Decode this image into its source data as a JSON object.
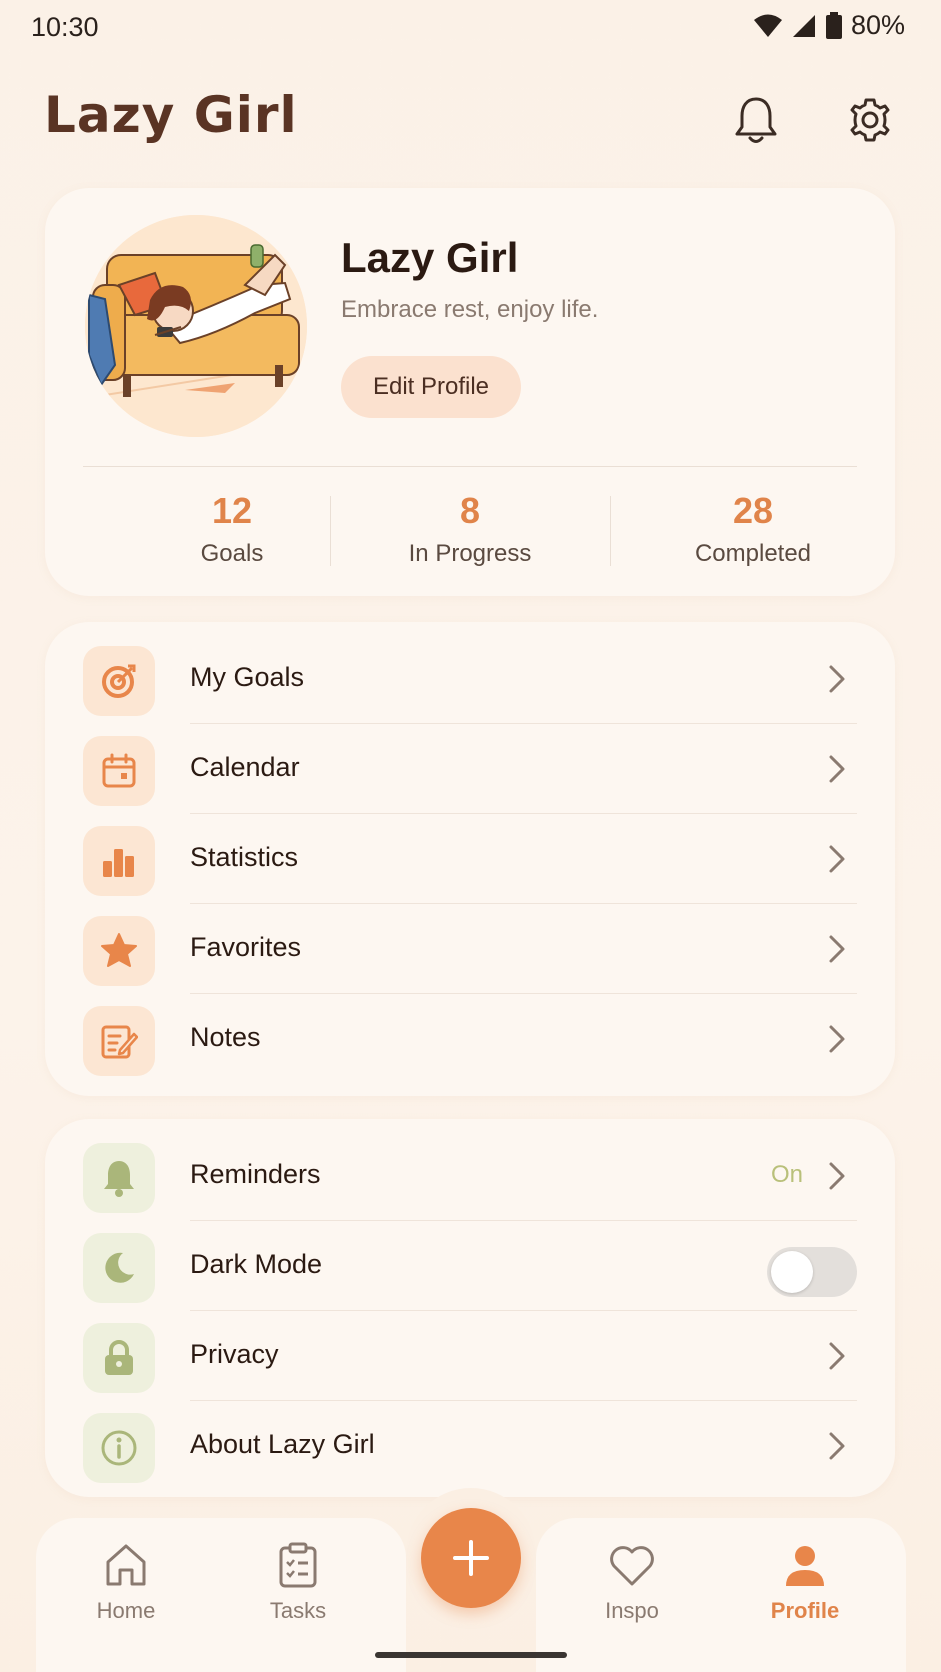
{
  "status_bar": {
    "time": "10:30",
    "battery": "80%"
  },
  "header": {
    "title": "Lazy Girl"
  },
  "profile": {
    "name": "Lazy Girl",
    "tagline": "Embrace rest, enjoy life.",
    "edit_label": "Edit Profile",
    "stats": [
      {
        "value": "12",
        "label": "Goals"
      },
      {
        "value": "8",
        "label": "In Progress"
      },
      {
        "value": "28",
        "label": "Completed"
      }
    ]
  },
  "menu_primary": [
    {
      "label": "My Goals",
      "icon": "target-icon"
    },
    {
      "label": "Calendar",
      "icon": "calendar-icon"
    },
    {
      "label": "Statistics",
      "icon": "bar-chart-icon"
    },
    {
      "label": "Favorites",
      "icon": "star-icon"
    },
    {
      "label": "Notes",
      "icon": "note-edit-icon"
    }
  ],
  "menu_settings": [
    {
      "label": "Reminders",
      "icon": "bell-icon",
      "value": "On"
    },
    {
      "label": "Dark Mode",
      "icon": "moon-icon",
      "toggle": false
    },
    {
      "label": "Privacy",
      "icon": "lock-icon"
    },
    {
      "label": "About Lazy Girl",
      "icon": "info-icon"
    }
  ],
  "bottom_nav": [
    {
      "label": "Home",
      "icon": "home-icon"
    },
    {
      "label": "Tasks",
      "icon": "clipboard-icon"
    },
    {
      "label": "Inspo",
      "icon": "heart-icon"
    },
    {
      "label": "Profile",
      "icon": "person-icon",
      "active": true
    }
  ],
  "colors": {
    "accent": "#e0844a",
    "background": "#fbf1e7",
    "card": "#fdf7f1",
    "green_tint": "#b9c07a"
  }
}
